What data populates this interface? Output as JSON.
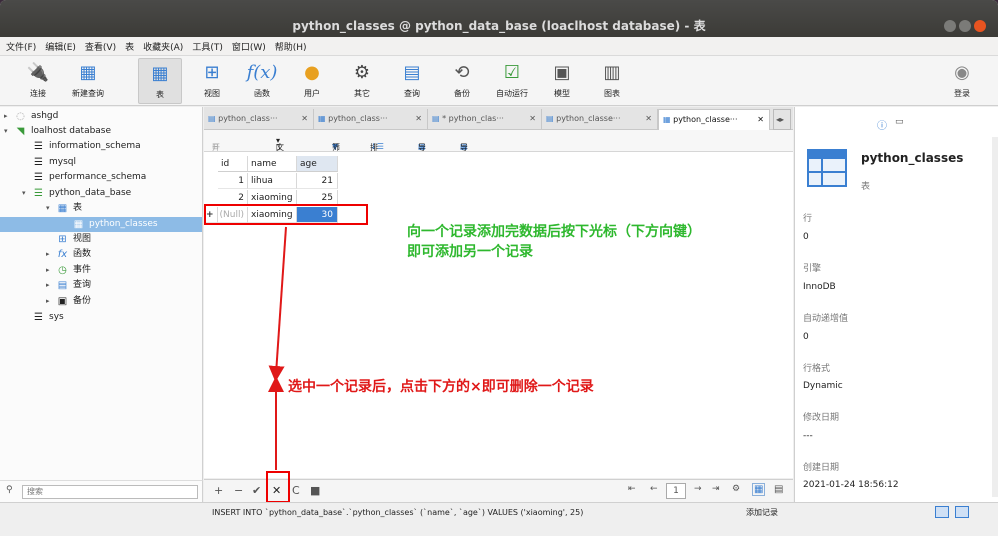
{
  "window": {
    "title": "python_classes @ python_data_base (loaclhost database) - 表"
  },
  "menu": [
    "文件(F)",
    "编辑(E)",
    "查看(V)",
    "表",
    "收藏夹(A)",
    "工具(T)",
    "窗口(W)",
    "帮助(H)"
  ],
  "toolbar": {
    "connect": "连接",
    "new_query": "新建查询",
    "table": "表",
    "view": "视图",
    "function": "函数",
    "user": "用户",
    "other": "其它",
    "query": "查询",
    "backup": "备份",
    "auto_run": "自动运行",
    "model": "模型",
    "chart": "图表",
    "login": "登录"
  },
  "tree": {
    "conn1": "ashgd",
    "conn2": "loalhost database",
    "db1": "information_schema",
    "db2": "mysql",
    "db3": "performance_schema",
    "db4": "python_data_base",
    "tables": "表",
    "table1": "python_classes",
    "views": "视图",
    "functions": "函数",
    "events": "事件",
    "queries": "查询",
    "backups": "备份",
    "db5": "sys"
  },
  "search": {
    "placeholder": "搜索"
  },
  "tabs": [
    "python_class···",
    "python_class···",
    "* python_clas···",
    "python_classe···",
    "python_classe···"
  ],
  "subtoolbar": {
    "begin_tx": "开始事务",
    "text": "文本",
    "filter": "筛选",
    "sort": "排序",
    "import": "导入",
    "export": "导出"
  },
  "table": {
    "columns": [
      "id",
      "name",
      "age"
    ],
    "rows": [
      {
        "id": "1",
        "name": "lihua",
        "age": "21"
      },
      {
        "id": "2",
        "name": "xiaoming",
        "age": "25"
      },
      {
        "id": "(Null)",
        "name": "xiaoming",
        "age": "30"
      }
    ],
    "new_row_marker": "+"
  },
  "annotations": {
    "add_note_line1": "向一个记录添加完数据后按下光标（下方向键）",
    "add_note_line2": "即可添加另一个记录",
    "delete_note": "选中一个记录后，点击下方的×即可删除一个记录"
  },
  "bottom": {
    "page": "1",
    "add_btn": "+",
    "remove_btn": "−",
    "confirm_btn": "✔",
    "delete_btn": "✕",
    "refresh_btn": "C",
    "stop_btn": "■"
  },
  "status": {
    "sql": "INSERT INTO `python_data_base`.`python_classes` (`name`, `age`) VALUES ('xiaoming', 25)",
    "action": "添加记录"
  },
  "info": {
    "name": "python_classes",
    "type": "表",
    "rows_label": "行",
    "rows": "0",
    "engine_label": "引擎",
    "engine": "InnoDB",
    "autoinc_label": "自动递增值",
    "autoinc": "0",
    "rowformat_label": "行格式",
    "rowformat": "Dynamic",
    "modified_label": "修改日期",
    "modified": "---",
    "created_label": "创建日期",
    "created": "2021-01-24 18:56:12"
  },
  "colors": {
    "accent": "#e95420",
    "selection": "#3a7fd1",
    "note_green": "#2eb82e",
    "note_red": "#e01818"
  }
}
